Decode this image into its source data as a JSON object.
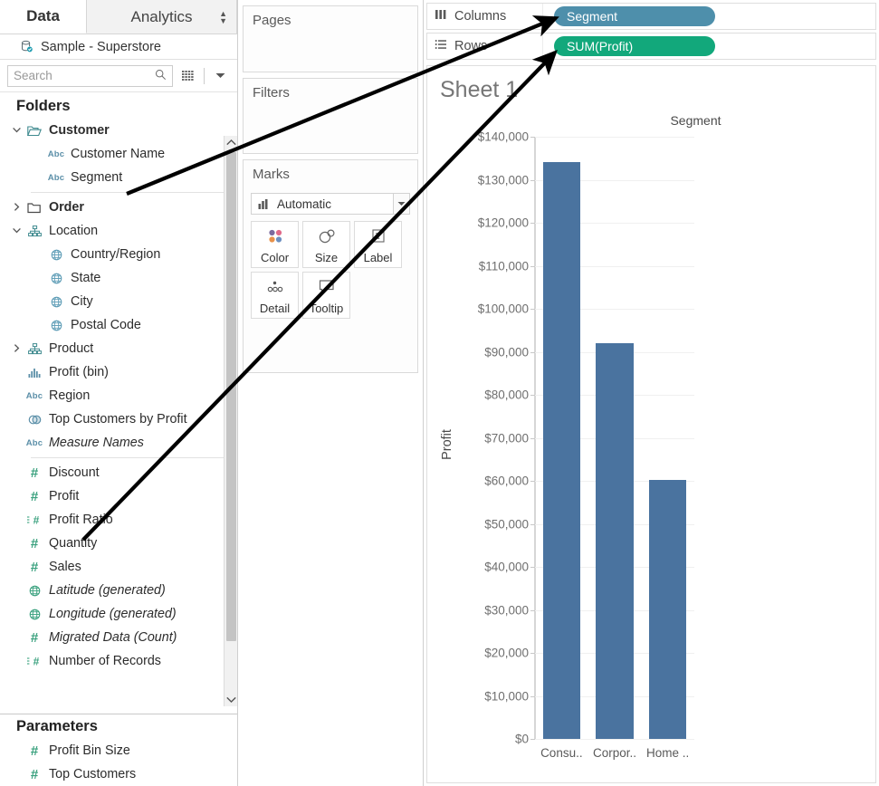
{
  "window": {
    "tabs": [
      {
        "label": "Data",
        "active": true
      },
      {
        "label": "Analytics",
        "active": false
      }
    ],
    "sort_icon": "updown-arrows-icon"
  },
  "datasource": {
    "name": "Sample - Superstore",
    "icon": "database-icon"
  },
  "search": {
    "placeholder": "Search",
    "value": "",
    "search_icon": "search-icon",
    "grid_icon": "grid-view-icon",
    "dropdown_icon": "chevron-down-icon"
  },
  "data_pane": {
    "folders_header": "Folders",
    "parameters_header": "Parameters",
    "scroll_up_icon": "chevron-up-icon",
    "scroll_down_icon": "chevron-down-icon",
    "fields": [
      {
        "label": "Customer",
        "icon": "folder-open-icon",
        "caret": "expanded",
        "indent": 0,
        "bold": true,
        "italic": false
      },
      {
        "label": "Customer Name",
        "icon": "abc-icon",
        "caret": "none",
        "indent": 1,
        "bold": false,
        "italic": false
      },
      {
        "label": "Segment",
        "icon": "abc-icon",
        "caret": "none",
        "indent": 1,
        "bold": false,
        "italic": false
      },
      {
        "label": "__separator__",
        "icon": "",
        "caret": "none",
        "indent": 1,
        "bold": false,
        "italic": false
      },
      {
        "label": "Order",
        "icon": "folder-closed-icon",
        "caret": "collapsed",
        "indent": 0,
        "bold": true,
        "italic": false
      },
      {
        "label": "Location",
        "icon": "hierarchy-icon",
        "caret": "expanded",
        "indent": 0,
        "bold": false,
        "italic": false
      },
      {
        "label": "Country/Region",
        "icon": "globe-icon",
        "caret": "none",
        "indent": 1,
        "bold": false,
        "italic": false
      },
      {
        "label": "State",
        "icon": "globe-icon",
        "caret": "none",
        "indent": 1,
        "bold": false,
        "italic": false
      },
      {
        "label": "City",
        "icon": "globe-icon",
        "caret": "none",
        "indent": 1,
        "bold": false,
        "italic": false
      },
      {
        "label": "Postal Code",
        "icon": "globe-icon",
        "caret": "none",
        "indent": 1,
        "bold": false,
        "italic": false
      },
      {
        "label": "Product",
        "icon": "hierarchy-icon",
        "caret": "collapsed",
        "indent": 0,
        "bold": false,
        "italic": false
      },
      {
        "label": "Profit (bin)",
        "icon": "bin-icon",
        "caret": "none",
        "indent": 0,
        "bold": false,
        "italic": false
      },
      {
        "label": "Region",
        "icon": "abc-icon",
        "caret": "none",
        "indent": 0,
        "bold": false,
        "italic": false
      },
      {
        "label": "Top Customers by Profit",
        "icon": "set-icon",
        "caret": "none",
        "indent": 0,
        "bold": false,
        "italic": false
      },
      {
        "label": "Measure Names",
        "icon": "abc-icon",
        "caret": "none",
        "indent": 0,
        "bold": false,
        "italic": true
      },
      {
        "label": "__separator__",
        "icon": "",
        "caret": "none",
        "indent": 0,
        "bold": false,
        "italic": false
      },
      {
        "label": "Discount",
        "icon": "number-icon",
        "caret": "none",
        "indent": 0,
        "bold": false,
        "italic": false
      },
      {
        "label": "Profit",
        "icon": "number-icon",
        "caret": "none",
        "indent": 0,
        "bold": false,
        "italic": false
      },
      {
        "label": "Profit Ratio",
        "icon": "calculated-number-icon",
        "caret": "none",
        "indent": 0,
        "bold": false,
        "italic": false
      },
      {
        "label": "Quantity",
        "icon": "number-icon",
        "caret": "none",
        "indent": 0,
        "bold": false,
        "italic": false
      },
      {
        "label": "Sales",
        "icon": "number-icon",
        "caret": "none",
        "indent": 0,
        "bold": false,
        "italic": false
      },
      {
        "label": "Latitude (generated)",
        "icon": "globe-green-icon",
        "caret": "none",
        "indent": 0,
        "bold": false,
        "italic": true
      },
      {
        "label": "Longitude (generated)",
        "icon": "globe-green-icon",
        "caret": "none",
        "indent": 0,
        "bold": false,
        "italic": true
      },
      {
        "label": "Migrated Data (Count)",
        "icon": "number-icon",
        "caret": "none",
        "indent": 0,
        "bold": false,
        "italic": true
      },
      {
        "label": "Number of Records",
        "icon": "calculated-number-icon",
        "caret": "none",
        "indent": 0,
        "bold": false,
        "italic": false
      }
    ],
    "parameters": [
      {
        "label": "Profit Bin Size",
        "icon": "number-icon"
      },
      {
        "label": "Top Customers",
        "icon": "number-icon"
      }
    ]
  },
  "cards": {
    "pages": {
      "title": "Pages"
    },
    "filters": {
      "title": "Filters"
    },
    "marks": {
      "title": "Marks",
      "type_label": "Automatic",
      "type_icon": "bar-chart-icon",
      "dropdown_icon": "chevron-down-icon",
      "buttons": [
        {
          "label": "Color",
          "icon": "color-dots-icon"
        },
        {
          "label": "Size",
          "icon": "size-circles-icon"
        },
        {
          "label": "Label",
          "icon": "label-t-icon"
        },
        {
          "label": "Detail",
          "icon": "detail-dots-icon"
        },
        {
          "label": "Tooltip",
          "icon": "tooltip-bubble-icon"
        }
      ]
    }
  },
  "shelves": {
    "columns": {
      "label": "Columns",
      "icon": "columns-icon",
      "pill": "Segment",
      "pill_type": "dimension"
    },
    "rows": {
      "label": "Rows",
      "icon": "rows-icon",
      "pill": "SUM(Profit)",
      "pill_type": "measure"
    }
  },
  "sheet": {
    "title": "Sheet 1"
  },
  "colors": {
    "bar": "#4a739f",
    "dimension_pill": "#4e8fab",
    "measure_pill": "#12a87b",
    "annotation_arrow": "#000000"
  },
  "chart_data": {
    "type": "bar",
    "title": "Sheet 1",
    "column_header": "Segment",
    "xlabel": "",
    "ylabel": "Profit",
    "categories": [
      "Consu..",
      "Corpor..",
      "Home .."
    ],
    "full_categories": [
      "Consumer",
      "Corporate",
      "Home Office"
    ],
    "values": [
      134119,
      91979,
      60299
    ],
    "ylim": [
      0,
      140000
    ],
    "ytick_labels": [
      "$0",
      "$10,000",
      "$20,000",
      "$30,000",
      "$40,000",
      "$50,000",
      "$60,000",
      "$70,000",
      "$80,000",
      "$90,000",
      "$100,000",
      "$110,000",
      "$120,000",
      "$130,000",
      "$140,000"
    ],
    "ytick_values": [
      0,
      10000,
      20000,
      30000,
      40000,
      50000,
      60000,
      70000,
      80000,
      90000,
      100000,
      110000,
      120000,
      130000,
      140000
    ],
    "grid": true,
    "legend": "none"
  },
  "annotations": [
    {
      "name": "arrow-segment-to-columns",
      "from": "Segment field",
      "to": "Columns shelf pill"
    },
    {
      "name": "arrow-profit-to-rows",
      "from": "Profit field",
      "to": "Rows shelf pill"
    }
  ]
}
